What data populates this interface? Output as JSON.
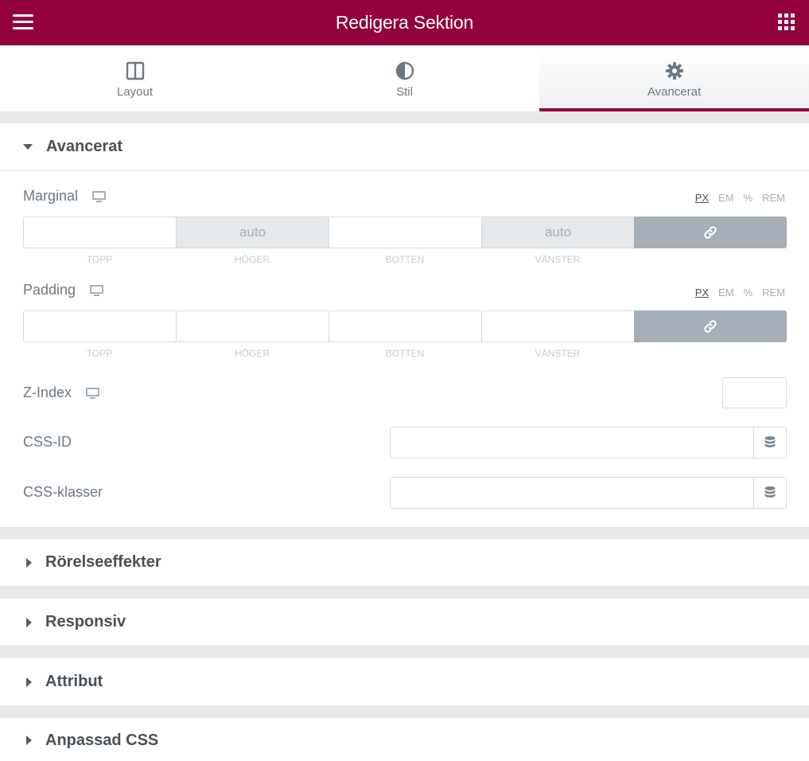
{
  "header": {
    "title": "Redigera Sektion",
    "menu_icon": "hamburger-icon",
    "widgets_icon": "grid-icon"
  },
  "tabs": [
    {
      "label": "Layout",
      "icon": "columns-icon",
      "active": false
    },
    {
      "label": "Stil",
      "icon": "half-circle-icon",
      "active": false
    },
    {
      "label": "Avancerat",
      "icon": "gear-icon",
      "active": true
    }
  ],
  "advanced": {
    "title": "Avancerat",
    "margin": {
      "label": "Marginal",
      "units": [
        "PX",
        "EM",
        "%",
        "REM"
      ],
      "active_unit": "PX",
      "values": [
        "",
        "auto",
        "",
        "auto"
      ],
      "sides": [
        "TOPP",
        "HÖGER",
        "BOTTEN",
        "VÄNSTER"
      ]
    },
    "padding": {
      "label": "Padding",
      "units": [
        "PX",
        "EM",
        "%",
        "REM"
      ],
      "active_unit": "PX",
      "values": [
        "",
        "",
        "",
        ""
      ],
      "sides": [
        "TOPP",
        "HÖGER",
        "BOTTEN",
        "VÄNSTER"
      ]
    },
    "zindex": {
      "label": "Z-Index",
      "value": ""
    },
    "css_id": {
      "label": "CSS-ID",
      "value": ""
    },
    "css_classes": {
      "label": "CSS-klasser",
      "value": ""
    }
  },
  "collapsed_sections": [
    "Rörelseeffekter",
    "Responsiv",
    "Attribut",
    "Anpassad CSS"
  ],
  "colors": {
    "brand": "#93003c",
    "text": "#6d7882",
    "muted": "#a4afb7"
  }
}
